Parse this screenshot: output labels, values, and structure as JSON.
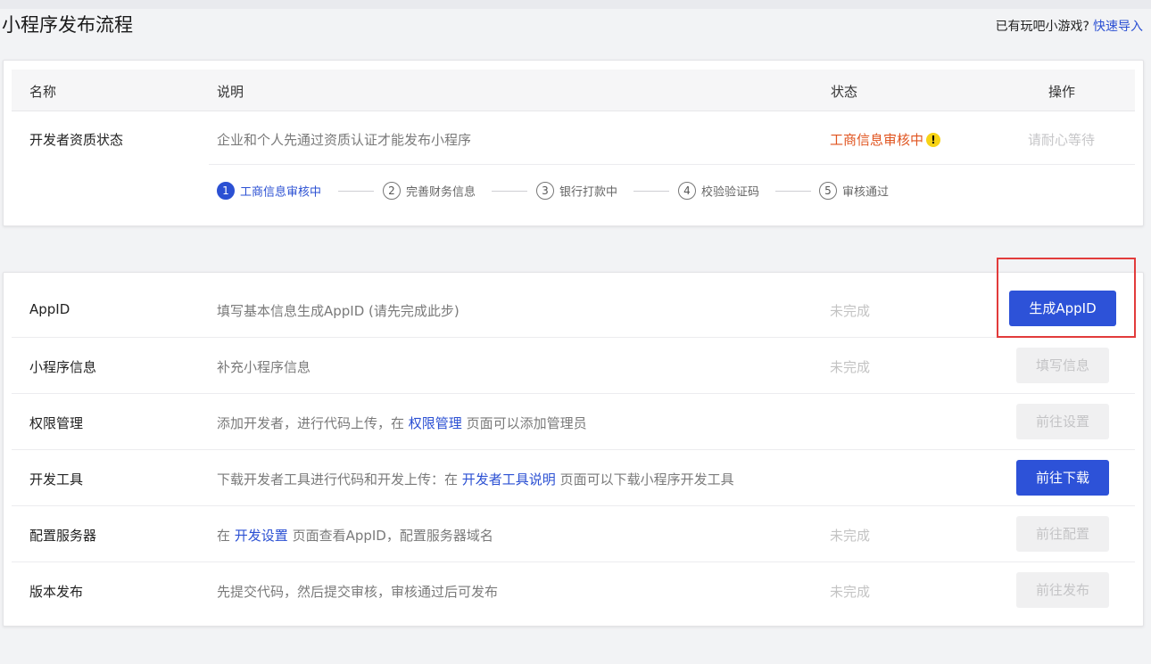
{
  "page": {
    "title": "小程序发布流程",
    "top_right_text": "已有玩吧小游戏?",
    "top_right_link": "快速导入"
  },
  "table_head": {
    "name": "名称",
    "desc": "说明",
    "status": "状态",
    "action": "操作"
  },
  "qualification": {
    "name": "开发者资质状态",
    "desc": "企业和个人先通过资质认证才能发布小程序",
    "status": "工商信息审核中",
    "status_icon": "!",
    "action": "请耐心等待",
    "steps": [
      {
        "num": "1",
        "label": "工商信息审核中"
      },
      {
        "num": "2",
        "label": "完善财务信息"
      },
      {
        "num": "3",
        "label": "银行打款中"
      },
      {
        "num": "4",
        "label": "校验验证码"
      },
      {
        "num": "5",
        "label": "审核通过"
      }
    ]
  },
  "tasks": [
    {
      "name": "AppID",
      "desc": "填写基本信息生成AppID (请先完成此步)",
      "status": "未完成",
      "button": "生成AppID"
    },
    {
      "name": "小程序信息",
      "desc": "补充小程序信息",
      "status": "未完成",
      "button": "填写信息"
    },
    {
      "name": "权限管理",
      "desc_pre": "添加开发者，进行代码上传，在 ",
      "desc_link": "权限管理",
      "desc_post": " 页面可以添加管理员",
      "button": "前往设置"
    },
    {
      "name": "开发工具",
      "desc_pre": "下载开发者工具进行代码和开发上传：在 ",
      "desc_link": "开发者工具说明",
      "desc_post": " 页面可以下载小程序开发工具",
      "button": "前往下载"
    },
    {
      "name": "配置服务器",
      "desc_pre": "在 ",
      "desc_link": "开发设置",
      "desc_post": " 页面查看AppID，配置服务器域名",
      "status": "未完成",
      "button": "前往配置"
    },
    {
      "name": "版本发布",
      "desc": "先提交代码，然后提交审核，审核通过后可发布",
      "status": "未完成",
      "button": "前往发布"
    }
  ],
  "colors": {
    "accent": "#2d52d8",
    "warning": "#e0541f",
    "highlight": "#e23b3b"
  }
}
